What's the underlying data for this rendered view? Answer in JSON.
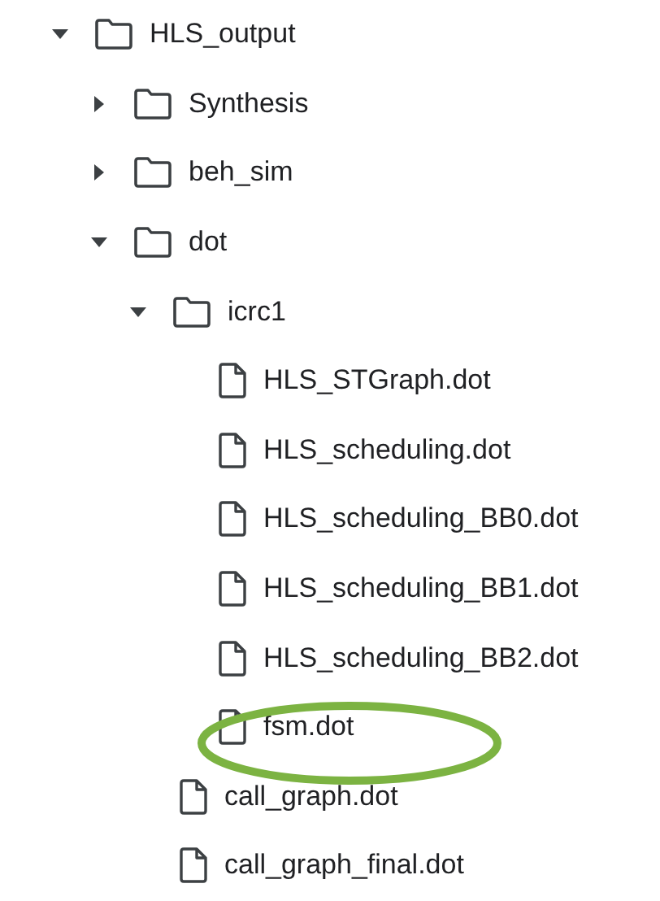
{
  "tree": [
    {
      "kind": "folder",
      "name": "HLS_output",
      "expanded": true,
      "children": [
        {
          "kind": "folder",
          "name": "Synthesis",
          "expanded": false
        },
        {
          "kind": "folder",
          "name": "beh_sim",
          "expanded": false
        },
        {
          "kind": "folder",
          "name": "dot",
          "expanded": true,
          "children": [
            {
              "kind": "folder",
              "name": "icrc1",
              "expanded": true,
              "children": [
                {
                  "kind": "file",
                  "name": "HLS_STGraph.dot",
                  "circled": false
                },
                {
                  "kind": "file",
                  "name": "HLS_scheduling.dot",
                  "circled": false
                },
                {
                  "kind": "file",
                  "name": "HLS_scheduling_BB0.dot",
                  "circled": false
                },
                {
                  "kind": "file",
                  "name": "HLS_scheduling_BB1.dot",
                  "circled": false
                },
                {
                  "kind": "file",
                  "name": "HLS_scheduling_BB2.dot",
                  "circled": false
                },
                {
                  "kind": "file",
                  "name": "fsm.dot",
                  "circled": true
                }
              ]
            },
            {
              "kind": "file",
              "name": "call_graph.dot",
              "circled": false
            },
            {
              "kind": "file",
              "name": "call_graph_final.dot",
              "circled": false
            }
          ]
        }
      ]
    }
  ]
}
